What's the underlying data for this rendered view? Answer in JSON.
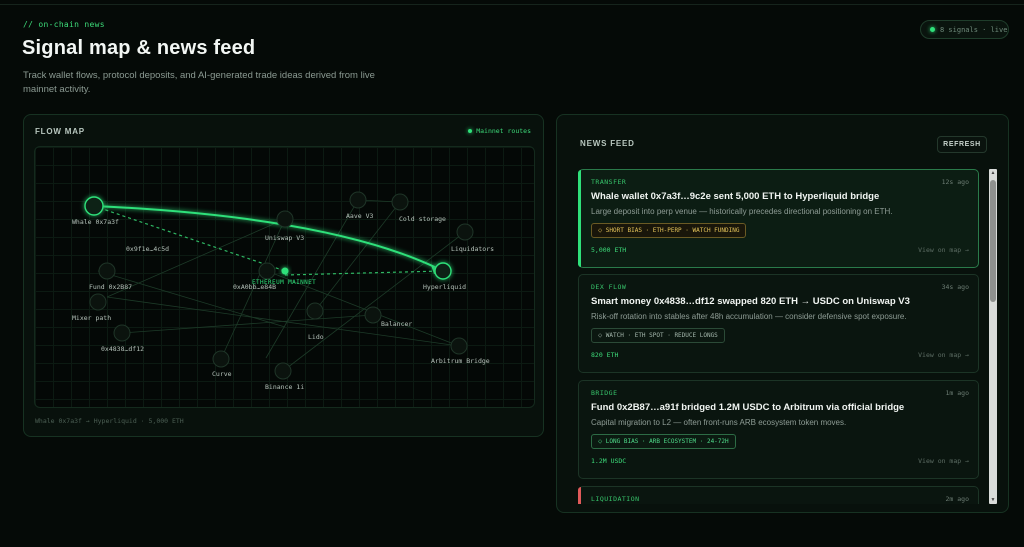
{
  "header": {
    "kicker": "// on-chain news",
    "title": "Signal map & news feed",
    "subtitle": "Track wallet flows, protocol deposits, and AI-generated trade ideas derived from live mainnet activity.",
    "live_label": "8 signals · live"
  },
  "flow_map": {
    "title": "FLOW MAP",
    "routes_label": "Mainnet routes",
    "center_label": "ETHEREUM MAINNET",
    "caption": "Whale 0x7a3f → Hyperliquid · 5,000 ETH",
    "nodes": {
      "whale": "Whale 0x7a3f",
      "aave": "Aave V3",
      "cold": "Cold storage",
      "uniswap": "Uniswap V3",
      "liquidators": "Liquidators",
      "addr_9f1e": "0x9f1e…4c5d",
      "fund": "Fund 0x2B87",
      "addr_a0bb": "0xA0bb…e84B",
      "hyperliquid": "Hyperliquid",
      "mixer": "Mixer path",
      "balancer": "Balancer",
      "lido": "Lido",
      "addr_4838": "0x4838…df12",
      "arbitrum": "Arbitrum Bridge",
      "curve": "Curve",
      "binance": "Binance 1i"
    }
  },
  "news_feed": {
    "title": "NEWS FEED",
    "refresh_label": "REFRESH",
    "cards": [
      {
        "tag": "TRANSFER",
        "time": "12s ago",
        "headline": "Whale wallet 0x7a3f…9c2e sent 5,000 ETH to Hyperliquid bridge",
        "desc": "Large deposit into perp venue — historically precedes directional positioning on ETH.",
        "chip": "⬦ SHORT BIAS · ETH-PERP · WATCH FUNDING",
        "amount": "5,000 ETH",
        "view": "View on map →"
      },
      {
        "tag": "DEX FLOW",
        "time": "34s ago",
        "headline": "Smart money 0x4838…df12 swapped 820 ETH → USDC on Uniswap V3",
        "desc": "Risk-off rotation into stables after 48h accumulation — consider defensive spot exposure.",
        "chip": "⬦ WATCH · ETH SPOT · REDUCE LONGS",
        "amount": "820 ETH",
        "view": "View on map →"
      },
      {
        "tag": "BRIDGE",
        "time": "1m ago",
        "headline": "Fund 0x2B87…a91f bridged 1.2M USDC to Arbitrum via official bridge",
        "desc": "Capital migration to L2 — often front-runs ARB ecosystem token moves.",
        "chip": "⬦ LONG BIAS · ARB ECOSYSTEM · 24-72H",
        "amount": "1.2M USDC",
        "view": "View on map →"
      },
      {
        "tag": "LIQUIDATION",
        "time": "2m ago"
      }
    ]
  },
  "colors": {
    "accent": "#2fe07a",
    "background": "#050a07",
    "short_bias": "#e4c45a",
    "liquidation": "#e05a5a"
  }
}
